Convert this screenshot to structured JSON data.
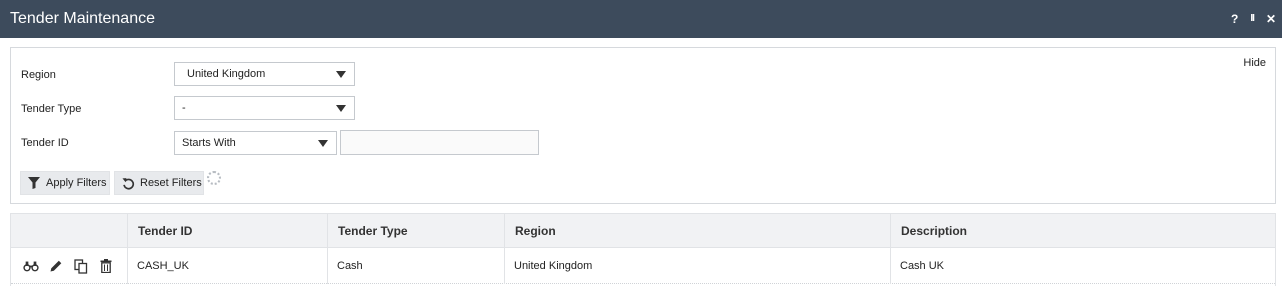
{
  "window": {
    "title": "Tender Maintenance",
    "help_label": "?",
    "pause_label": "II",
    "close_label": "✕"
  },
  "filters": {
    "hide_label": "Hide",
    "region": {
      "label": "Region",
      "value": "United Kingdom"
    },
    "tender_type": {
      "label": "Tender Type",
      "value": "-"
    },
    "tender_id": {
      "label": "Tender ID",
      "operator": "Starts With",
      "value": ""
    },
    "apply_label": "Apply Filters",
    "reset_label": "Reset Filters"
  },
  "grid": {
    "columns": [
      "Tender ID",
      "Tender Type",
      "Region",
      "Description"
    ],
    "rows": [
      {
        "tender_id": "CASH_UK",
        "tender_type": "Cash",
        "region": "United Kingdom",
        "description": "Cash UK"
      }
    ],
    "row_actions": [
      "view-icon",
      "edit-icon",
      "copy-icon",
      "delete-icon"
    ]
  },
  "colors": {
    "titlebar_bg": "#3d4b5c",
    "header_bg": "#f1f2f4",
    "button_bg": "#e8eaed"
  }
}
